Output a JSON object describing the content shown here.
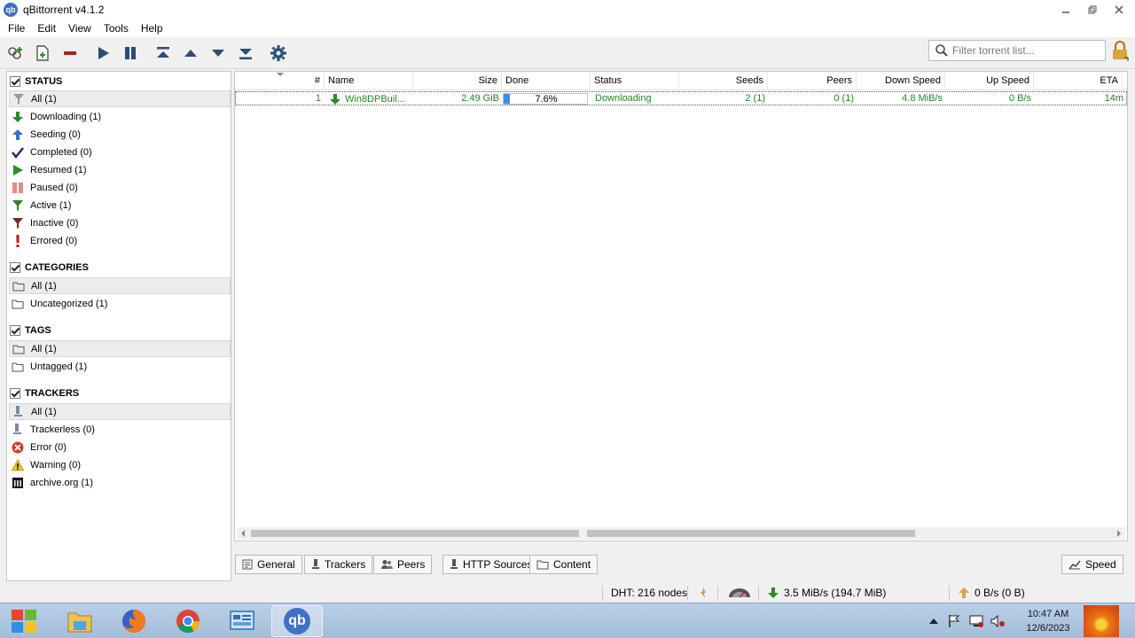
{
  "window": {
    "title": "qBittorrent v4.1.2",
    "app_icon_text": "qb"
  },
  "menu": [
    "File",
    "Edit",
    "View",
    "Tools",
    "Help"
  ],
  "filter": {
    "placeholder": "Filter torrent list..."
  },
  "sidebar": {
    "status": {
      "header": "STATUS",
      "items": [
        {
          "label": "All (1)",
          "icon": "filter-icon"
        },
        {
          "label": "Downloading (1)",
          "icon": "download-arrow-icon"
        },
        {
          "label": "Seeding (0)",
          "icon": "upload-arrow-icon"
        },
        {
          "label": "Completed (0)",
          "icon": "checkmark-icon"
        },
        {
          "label": "Resumed (1)",
          "icon": "play-icon"
        },
        {
          "label": "Paused (0)",
          "icon": "pause-icon"
        },
        {
          "label": "Active (1)",
          "icon": "filter-green-icon"
        },
        {
          "label": "Inactive (0)",
          "icon": "filter-red-icon"
        },
        {
          "label": "Errored (0)",
          "icon": "exclamation-icon"
        }
      ]
    },
    "categories": {
      "header": "CATEGORIES",
      "items": [
        {
          "label": "All (1)",
          "icon": "folder-icon"
        },
        {
          "label": "Uncategorized (1)",
          "icon": "folder-icon"
        }
      ]
    },
    "tags": {
      "header": "TAGS",
      "items": [
        {
          "label": "All (1)",
          "icon": "folder-icon"
        },
        {
          "label": "Untagged (1)",
          "icon": "folder-icon"
        }
      ]
    },
    "trackers": {
      "header": "TRACKERS",
      "items": [
        {
          "label": "All (1)",
          "icon": "tracker-icon"
        },
        {
          "label": "Trackerless (0)",
          "icon": "tracker-icon"
        },
        {
          "label": "Error (0)",
          "icon": "error-icon"
        },
        {
          "label": "Warning (0)",
          "icon": "warning-icon"
        },
        {
          "label": "archive.org (1)",
          "icon": "archive-icon"
        }
      ]
    }
  },
  "table": {
    "columns": [
      "#",
      "Name",
      "Size",
      "Done",
      "Status",
      "Seeds",
      "Peers",
      "Down Speed",
      "Up Speed",
      "ETA"
    ],
    "rows": [
      {
        "num": "1",
        "name": "Win8DPBuil...",
        "size": "2.49 GiB",
        "done": "7.6%",
        "progress": 0.076,
        "status": "Downloading",
        "seeds": "2 (1)",
        "peers": "0 (1)",
        "down_speed": "4.8 MiB/s",
        "up_speed": "0 B/s",
        "eta": "14m"
      }
    ]
  },
  "properties_tabs": [
    "General",
    "Trackers",
    "Peers",
    "HTTP Sources",
    "Content"
  ],
  "speed_button": "Speed",
  "statusbar": {
    "dht": "DHT: 216 nodes",
    "download": "3.5 MiB/s (194.7 MiB)",
    "upload": "0 B/s (0 B)"
  },
  "taskbar": {
    "time": "10:47 AM",
    "date": "12/6/2023",
    "qb_label": "qb"
  },
  "colors": {
    "downloading_text": "#1f8b1f",
    "progress_fill": "#3c8fe0",
    "title_bar": "#ffffff"
  }
}
